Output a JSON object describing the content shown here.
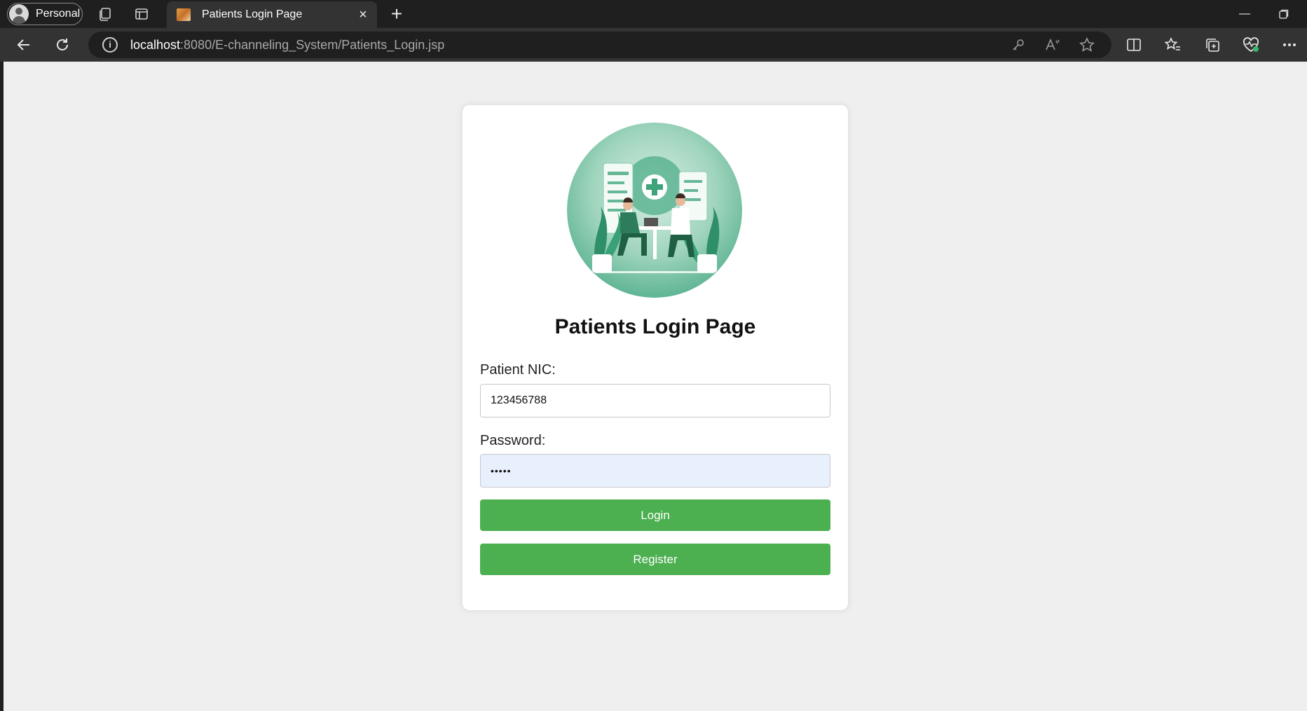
{
  "browser": {
    "profile_label": "Personal",
    "tab_title": "Patients Login Page",
    "address": {
      "host": "localhost",
      "path": ":8080/E-channeling_System/Patients_Login.jsp"
    },
    "icons": [
      "workspaces-icon",
      "tab-actions-icon",
      "back-icon",
      "refresh-icon",
      "info-icon",
      "key-icon",
      "read-aloud-icon",
      "favorite-star-icon",
      "split-screen-icon",
      "favorites-icon",
      "collections-icon",
      "browser-essentials-icon",
      "more-icon"
    ]
  },
  "login": {
    "title": "Patients Login Page",
    "nic_label": "Patient NIC:",
    "nic_value": "123456788",
    "password_label": "Password:",
    "password_value": "•••••",
    "login_button": "Login",
    "register_button": "Register"
  },
  "colors": {
    "primary_button": "#4caf50",
    "autofill_bg": "#e8f0fe",
    "page_bg": "#efefef",
    "illustration_accent": "#5fb594"
  }
}
